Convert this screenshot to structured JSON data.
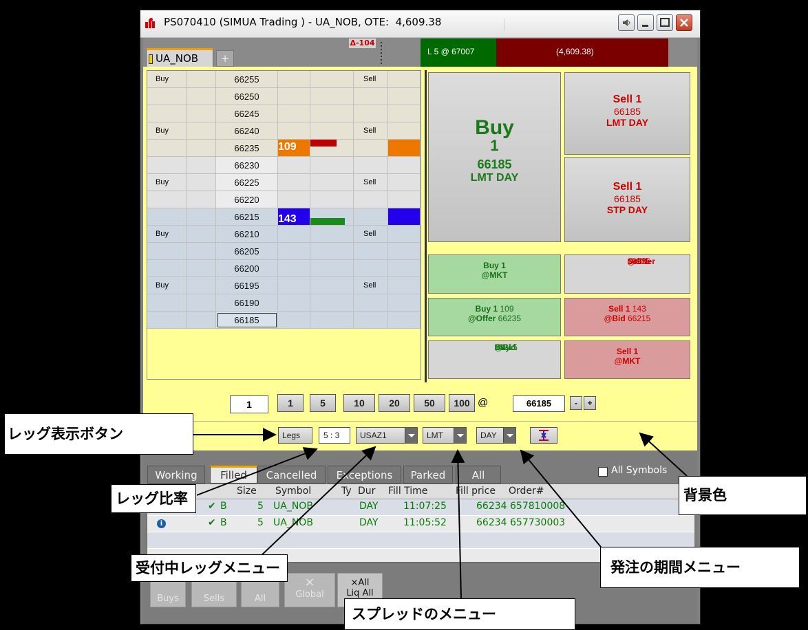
{
  "window": {
    "title": "PS070410 (SIMUA Trading ) - UA_NOB, OTE:  4,609.38"
  },
  "tabs": {
    "active_label": "UA_NOB",
    "add_label": "+",
    "delta_label": "Δ-104"
  },
  "position": {
    "label": "L 5 @ 67007"
  },
  "pnl": {
    "label": "(4,609.38)"
  },
  "ladder": {
    "buy_label": "Buy",
    "sell_label": "Sell",
    "prices": [
      "66255",
      "66250",
      "66245",
      "66240",
      "66235",
      "66230",
      "66225",
      "66220",
      "66215",
      "66210",
      "66205",
      "66200",
      "66195",
      "66190",
      "66185"
    ],
    "ask_size": "109",
    "bid_size": "143"
  },
  "big_buttons": {
    "buy_title": "Buy",
    "buy_qty": "1",
    "buy_price": "66185",
    "buy_type": "LMT DAY",
    "sell_lmt_title": "Sell 1",
    "sell_lmt_price": "66185",
    "sell_lmt_type": "LMT DAY",
    "sell_stp_title": "Sell 1",
    "sell_stp_price": "66185",
    "sell_stp_type": "STP DAY"
  },
  "quick_buttons": {
    "buy_mkt_1": "Buy 1",
    "buy_mkt_2": "@MKT",
    "sell_offer_1a": "Sell 1",
    "sell_offer_1b": " 109",
    "sell_offer_2a": "@Offer",
    "sell_offer_2b": " 66235",
    "buy_offer_1a": "Buy 1",
    "buy_offer_1b": " 109",
    "buy_offer_2a": "@Offer",
    "buy_offer_2b": " 66235",
    "sell_bid_1a": "Sell 1",
    "sell_bid_1b": " 143",
    "sell_bid_2a": "@Bid",
    "sell_bid_2b": " 66215",
    "buy_bid_1a": "Buy 1",
    "buy_bid_1b": " 143",
    "buy_bid_2a": "@Bid",
    "buy_bid_2b": " 66215",
    "sell_mkt_1": "Sell 1",
    "sell_mkt_2": "@MKT"
  },
  "quantity": {
    "value": "1",
    "presets": [
      "1",
      "5",
      "10",
      "20",
      "50",
      "100"
    ],
    "at": "@",
    "price": "66185",
    "minus": "-",
    "plus": "+"
  },
  "controls": {
    "legs_label": "Legs",
    "ratio": "5 : 3",
    "leg_menu": "USAZ1",
    "spread_menu": "LMT",
    "duration_menu": "DAY"
  },
  "orders": {
    "tabs": [
      "Working",
      "Filled",
      "Cancelled",
      "Exceptions",
      "Parked",
      "All"
    ],
    "all_symbols_label": "All Symbols",
    "headers": [
      "Size",
      "Symbol",
      "Ty",
      "Dur",
      "Fill Time",
      "Fill price",
      "Order#"
    ],
    "rows": [
      {
        "side": "B",
        "size": "5",
        "symbol": "UA_NOB",
        "dur": "DAY",
        "time": "11:07:25",
        "price": "66234",
        "order": "657810008"
      },
      {
        "side": "B",
        "size": "5",
        "symbol": "UA_NOB",
        "dur": "DAY",
        "time": "11:05:52",
        "price": "66234",
        "order": "657730003"
      }
    ]
  },
  "bottom_buttons": {
    "buys": "Buys",
    "sells": "Sells",
    "all": "All",
    "global_x": "×",
    "global": "Global",
    "liq_x": "×All",
    "liq": "Liq All"
  },
  "callouts": {
    "legs_button": "レッグ表示ボタン",
    "leg_ratio": "レッグ比率",
    "active_leg_menu": "受付中レッグメニュー",
    "background_color": "背景色",
    "duration_menu": "発注の期間メニュー",
    "spread_menu": "スプレッドのメニュー"
  },
  "colors": {
    "accent_yellow": "#ffff96",
    "ask_orange": "#ee7700",
    "bid_blue": "#2200ee",
    "buy_green": "#1a7a1a",
    "sell_red": "#cc0000"
  }
}
